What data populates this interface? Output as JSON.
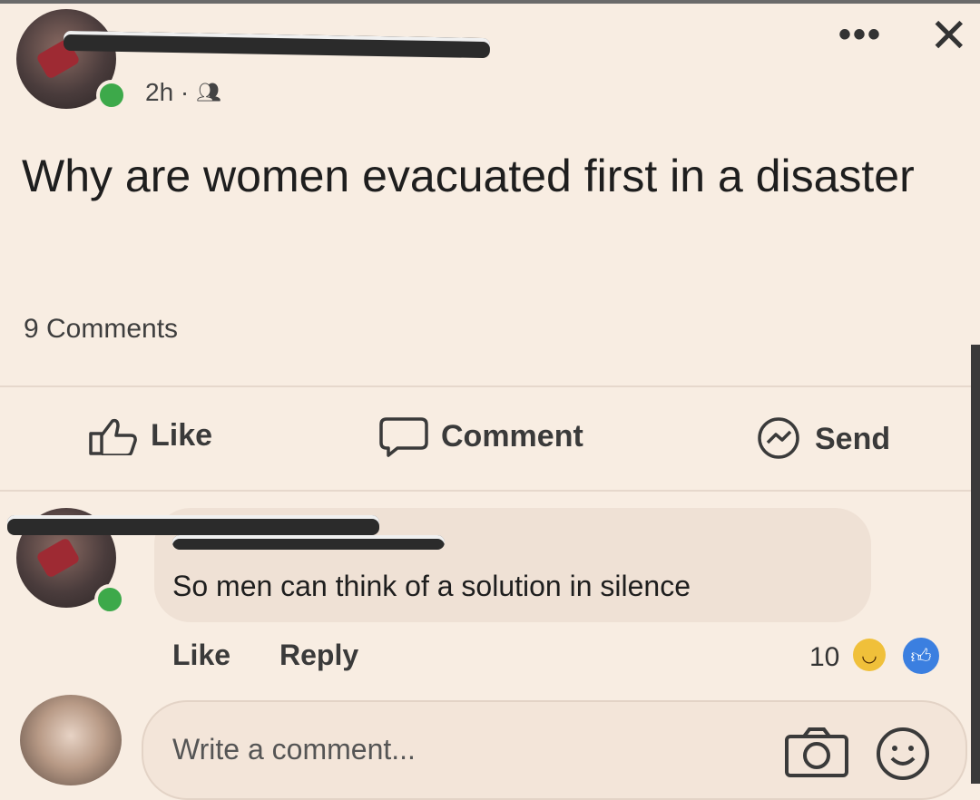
{
  "post": {
    "time_label": "2h ·",
    "audience_icon": "friends-icon",
    "text": "Why are women evacuated first in a disaster",
    "comments_count": "9 Comments"
  },
  "actions": {
    "like_label": "Like",
    "comment_label": "Comment",
    "send_label": "Send"
  },
  "comment": {
    "text": "So men can think of a solution in silence",
    "like_label": "Like",
    "reply_label": "Reply",
    "reaction_count": "10"
  },
  "composer": {
    "placeholder": "Write a comment..."
  },
  "colors": {
    "background": "#f8ede2",
    "online": "#3da94a",
    "like_reaction": "#3b7fe0",
    "haha_reaction": "#f0c03a"
  }
}
